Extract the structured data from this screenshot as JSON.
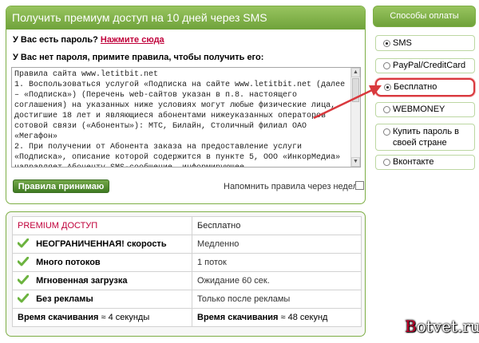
{
  "main": {
    "header": "Получить премиум доступ на 10 дней через SMS",
    "have_password_text": "У Вас есть пароль?",
    "have_password_link": "Нажмите сюда",
    "no_password_text": "У Вас нет пароля, примите правила, чтобы получить его:",
    "rules_text": "Правила сайта www.letitbit.net\n1. Воспользоваться услугой «Подписка на сайте www.letitbit.net (далее – «Подписка») (Перечень web-сайтов указан в п.8. настоящего соглашения) на указанных ниже условиях могут любые физические лица, достигшие 18 лет и являющиеся абонентами нижеуказанных операторов сотовой связи («Абоненты»): МТС, Билайн, Столичный филиал ОАО «Мегафон»\n2. При получении от Абонента заказа на предоставление услуги «Подписка», описание которой содержится в пункте 5, ООО «ИнкорМедиа» направляет Абоненту SMS-сообщение, информирующее",
    "accept_button": "Правила принимаю",
    "remind_label": "Напомнить правила через неделю"
  },
  "payment": {
    "header": "Способы оплаты",
    "options": [
      {
        "label": "SMS",
        "selected": true
      },
      {
        "label": "PayPal/CreditCard",
        "selected": false
      },
      {
        "label": "Бесплатно",
        "selected": true
      },
      {
        "label": "WEBMONEY",
        "selected": false
      },
      {
        "label_line1": "Купить пароль в",
        "label_line2": "своей стране",
        "selected": false
      },
      {
        "label": "Вконтакте",
        "selected": false
      }
    ],
    "highlight_color": "#d9383d"
  },
  "comparison": {
    "premium_header": "PREMIUM ДОСТУП",
    "free_header": "Бесплатно",
    "rows": [
      {
        "feature": "НЕОГРАНИЧЕННАЯ! скорость",
        "free": "Медленно"
      },
      {
        "feature": "Много потоков",
        "free": "1 поток"
      },
      {
        "feature": "Мгновенная загрузка",
        "free": "Ожидание 60 сек."
      },
      {
        "feature": "Без рекламы",
        "free": "Только после рекламы"
      }
    ],
    "download_label": "Время скачивания",
    "premium_time": "≈ 4 секунды",
    "free_time": "≈ 48 секунд"
  },
  "watermark": {
    "first": "B",
    "rest": "otvet.ru"
  },
  "icons": [
    "check-icon",
    "radio-icon",
    "arrow-annotation"
  ]
}
